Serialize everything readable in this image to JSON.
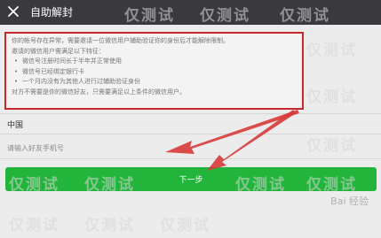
{
  "header": {
    "title": "自助解封"
  },
  "notice": {
    "intro": "你的帐号存在异常，需要邀请一位微信用户辅助验证你的身份后才能解除限制。",
    "requirement_heading": "邀请的微信用户需满足以下特征：",
    "requirements": [
      "微信号注册时间长于半年并正常使用",
      "微信号已经绑定银行卡",
      "一个月内没有为其他人进行过辅助验证身份"
    ],
    "footer": "对方不需要是你的微信好友，只需要满足以上条件的微信用户。"
  },
  "form": {
    "country": "中国",
    "phone_placeholder": "请输入好友手机号"
  },
  "actions": {
    "next_label": "下一步"
  },
  "watermark": {
    "text": "仅测试"
  },
  "branding": {
    "baidu_text": "Bai 经验"
  },
  "colors": {
    "topbar": "#3a3a3e",
    "highlight_border": "#c8282c",
    "next_button": "#23b43c",
    "arrow": "#d83a3a"
  }
}
